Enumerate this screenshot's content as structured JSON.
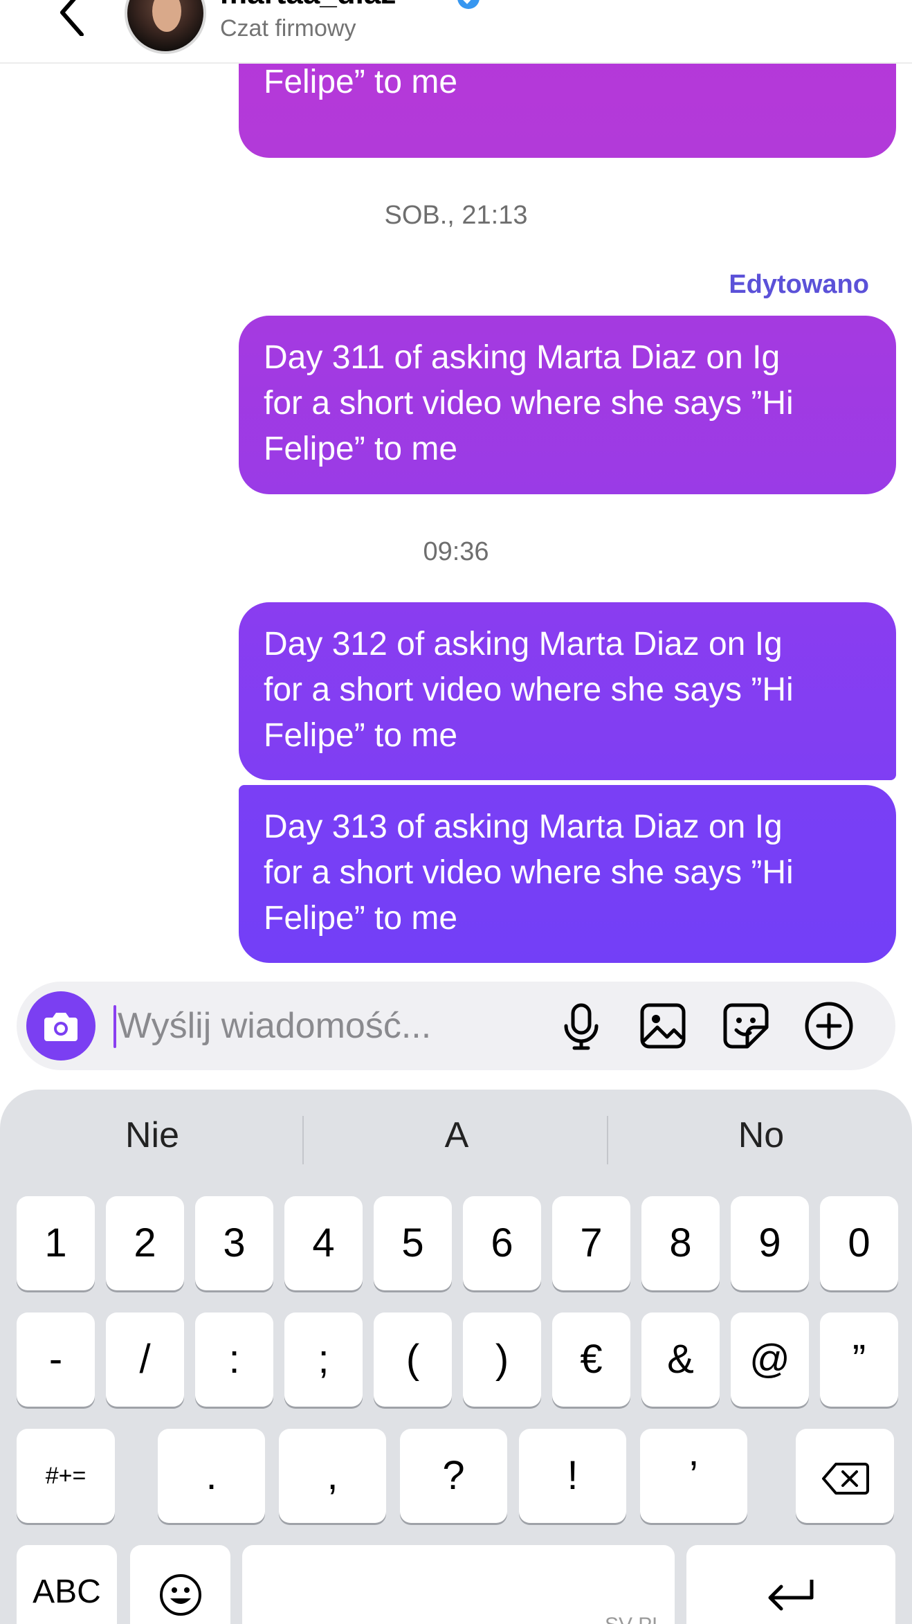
{
  "header": {
    "username": "martaa_diaz",
    "subtitle": "Czat firmowy",
    "back_icon": "chevron-left-icon",
    "verified_icon": "verified-badge-icon",
    "verified_color": "#3897f0"
  },
  "messages": [
    {
      "text": "for a short video where she says ”Hi\nFelipe” to me",
      "from": "me"
    },
    {
      "text": "Day 311 of asking Marta Diaz on Ig\nfor a short video where she says ”Hi\nFelipe” to me",
      "from": "me"
    },
    {
      "text": "Day 312 of asking Marta Diaz on Ig\nfor a short video where she says ”Hi\nFelipe” to me",
      "from": "me"
    },
    {
      "text": "Day 313 of asking Marta Diaz on Ig\nfor a short video where she says ”Hi\nFelipe” to me",
      "from": "me"
    }
  ],
  "timestamps": [
    "SOB., 21:13",
    "09:36"
  ],
  "edited_label": "Edytowano",
  "composer": {
    "placeholder": "Wyślij wiadomość...",
    "icons": [
      "camera-icon",
      "microphone-icon",
      "gallery-icon",
      "sticker-icon",
      "plus-circle-icon"
    ],
    "accent": "#7b3ff2"
  },
  "keyboard": {
    "suggestions": [
      "Nie",
      "A",
      "No"
    ],
    "row1": [
      "1",
      "2",
      "3",
      "4",
      "5",
      "6",
      "7",
      "8",
      "9",
      "0"
    ],
    "row2": [
      "-",
      "/",
      ":",
      ";",
      "(",
      ")",
      "€",
      "&",
      "@",
      "”"
    ],
    "row3": [
      "#+=",
      ".",
      ",",
      "?",
      "!",
      "’"
    ],
    "row4": {
      "abc": "ABC",
      "space_label": "SV PL"
    },
    "icons": [
      "delete-icon",
      "emoji-icon",
      "return-icon"
    ]
  }
}
